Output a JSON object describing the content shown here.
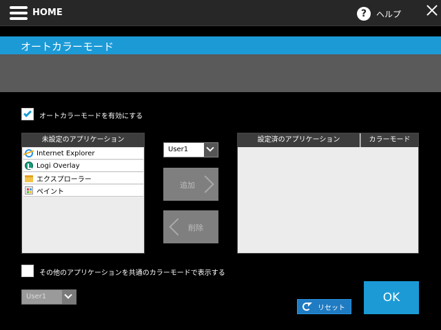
{
  "header": {
    "home_label": "HOME",
    "help_label": "ヘルプ",
    "help_icon_glyph": "?"
  },
  "title": "オートカラーモード",
  "enable_auto": {
    "label": "オートカラーモードを有効にする",
    "checked": true
  },
  "unset_apps": {
    "header": "未設定のアプリケーション",
    "items": [
      {
        "name": "Internet Explorer",
        "icon": "internet-explorer-icon"
      },
      {
        "name": "Logi Overlay",
        "icon": "logi-overlay-icon"
      },
      {
        "name": "エクスプローラー",
        "icon": "explorer-folder-icon"
      },
      {
        "name": "ペイント",
        "icon": "paint-icon"
      }
    ]
  },
  "user_select": {
    "value": "User1"
  },
  "add_button": {
    "label": "追加"
  },
  "remove_button": {
    "label": "削除"
  },
  "set_apps": {
    "header_app": "設定済のアプリケーション",
    "header_mode": "カラーモード",
    "items": []
  },
  "other_apps": {
    "label": "その他のアプリケーションを共通のカラーモードで表示する",
    "checked": false
  },
  "other_user_select": {
    "value": "User1",
    "disabled": true
  },
  "reset_button": {
    "label": "リセット"
  },
  "ok_button": {
    "label": "OK"
  },
  "colors": {
    "accent": "#1c9ad6",
    "topbar": "#272727",
    "band": "#5a5a5a",
    "reset": "#1f7bc2"
  }
}
